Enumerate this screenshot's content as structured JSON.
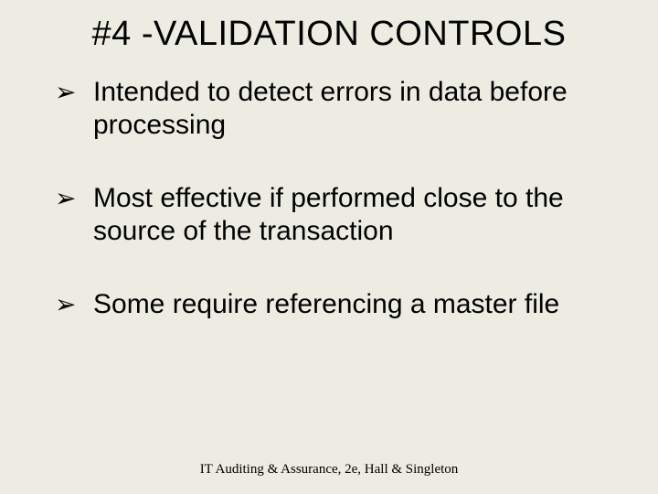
{
  "slide": {
    "title": "#4 -VALIDATION CONTROLS",
    "bullets": [
      "Intended to detect errors in data before processing",
      "Most effective if performed close to the source of the transaction",
      "Some require referencing a master file"
    ],
    "footer": "IT Auditing & Assurance, 2e, Hall & Singleton"
  }
}
